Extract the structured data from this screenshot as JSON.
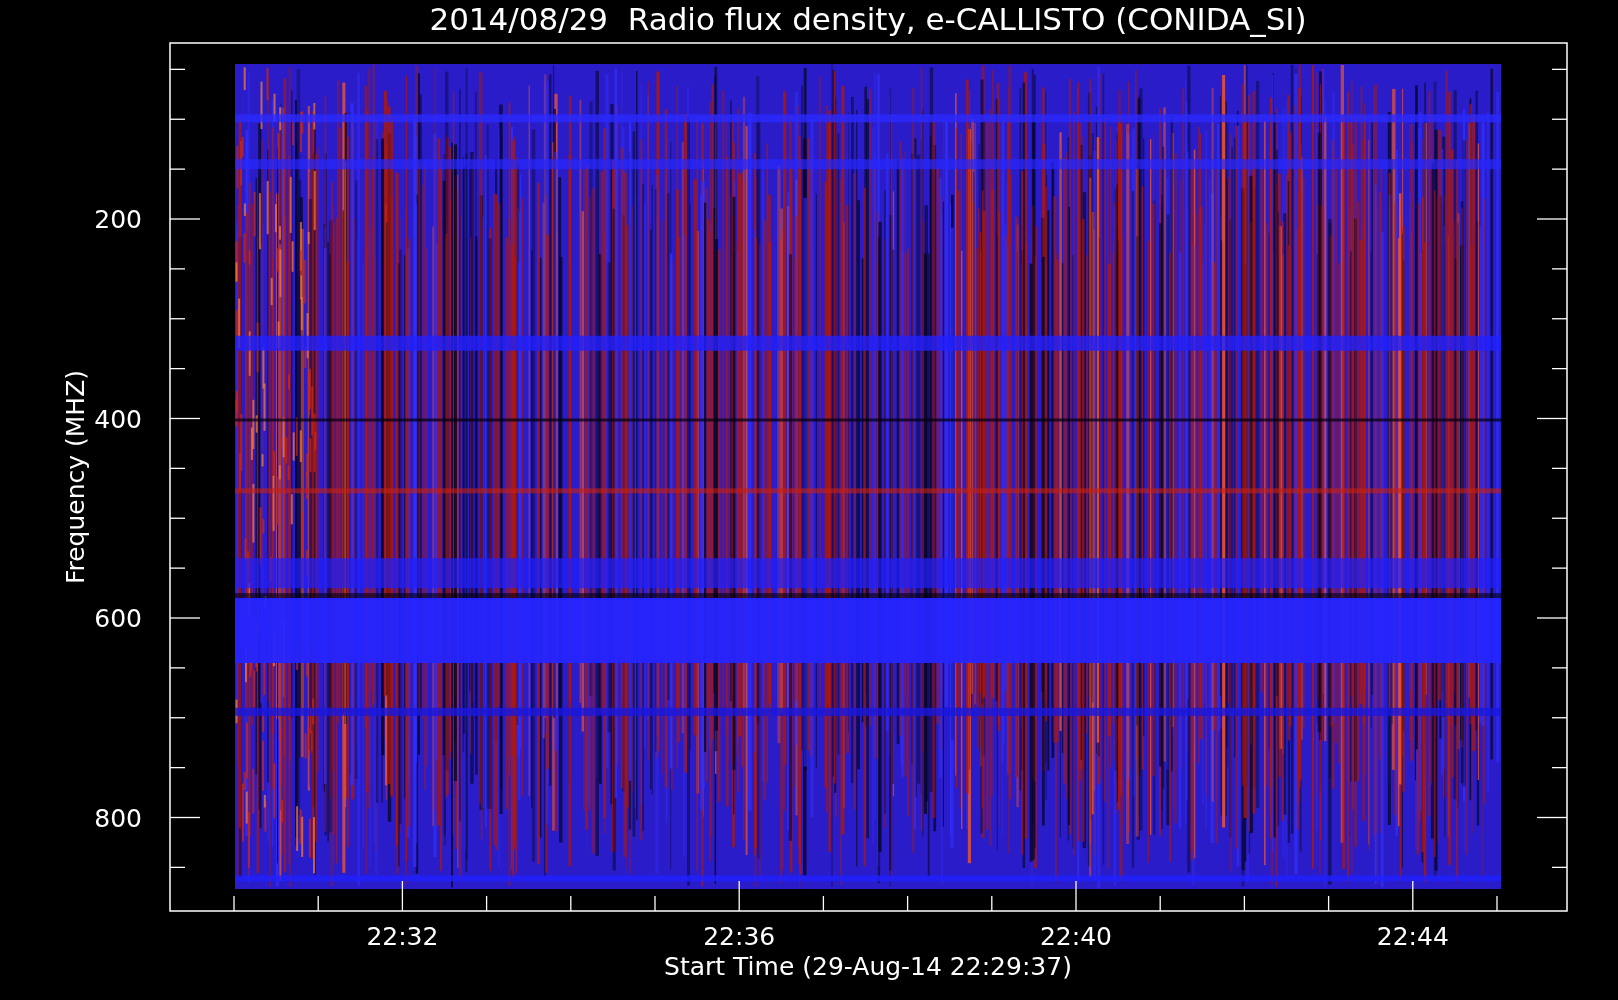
{
  "title": "2014/08/29  Radio flux density, e-CALLISTO (CONIDA_SI)",
  "y_axis": {
    "label": "Frequency (MHZ)",
    "tick_labels": [
      "200",
      "400",
      "600",
      "800"
    ]
  },
  "x_axis": {
    "label": "Start Time (29-Aug-14 22:29:37)",
    "tick_labels": [
      "22:32",
      "22:36",
      "22:40",
      "22:44"
    ]
  }
}
